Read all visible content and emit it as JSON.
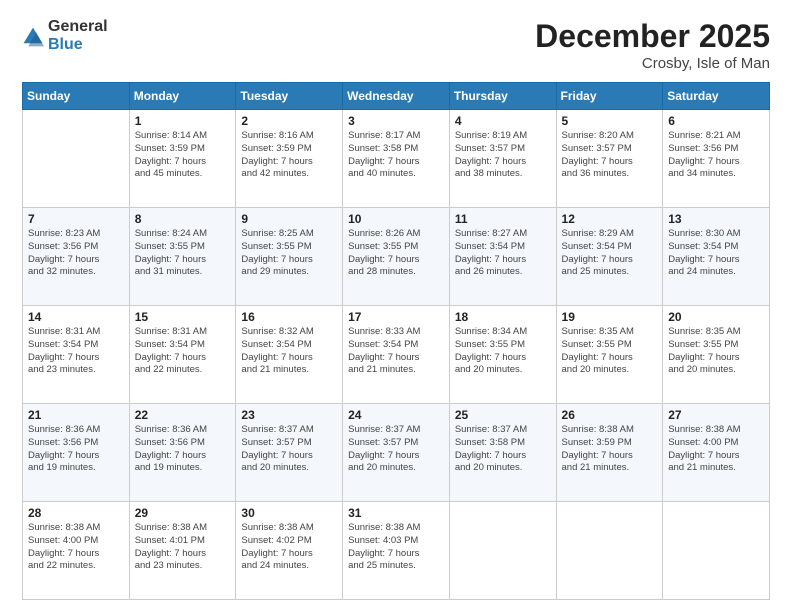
{
  "logo": {
    "general": "General",
    "blue": "Blue"
  },
  "header": {
    "month": "December 2025",
    "location": "Crosby, Isle of Man"
  },
  "days_of_week": [
    "Sunday",
    "Monday",
    "Tuesday",
    "Wednesday",
    "Thursday",
    "Friday",
    "Saturday"
  ],
  "weeks": [
    [
      {
        "day": "",
        "info": ""
      },
      {
        "day": "1",
        "info": "Sunrise: 8:14 AM\nSunset: 3:59 PM\nDaylight: 7 hours\nand 45 minutes."
      },
      {
        "day": "2",
        "info": "Sunrise: 8:16 AM\nSunset: 3:59 PM\nDaylight: 7 hours\nand 42 minutes."
      },
      {
        "day": "3",
        "info": "Sunrise: 8:17 AM\nSunset: 3:58 PM\nDaylight: 7 hours\nand 40 minutes."
      },
      {
        "day": "4",
        "info": "Sunrise: 8:19 AM\nSunset: 3:57 PM\nDaylight: 7 hours\nand 38 minutes."
      },
      {
        "day": "5",
        "info": "Sunrise: 8:20 AM\nSunset: 3:57 PM\nDaylight: 7 hours\nand 36 minutes."
      },
      {
        "day": "6",
        "info": "Sunrise: 8:21 AM\nSunset: 3:56 PM\nDaylight: 7 hours\nand 34 minutes."
      }
    ],
    [
      {
        "day": "7",
        "info": "Sunrise: 8:23 AM\nSunset: 3:56 PM\nDaylight: 7 hours\nand 32 minutes."
      },
      {
        "day": "8",
        "info": "Sunrise: 8:24 AM\nSunset: 3:55 PM\nDaylight: 7 hours\nand 31 minutes."
      },
      {
        "day": "9",
        "info": "Sunrise: 8:25 AM\nSunset: 3:55 PM\nDaylight: 7 hours\nand 29 minutes."
      },
      {
        "day": "10",
        "info": "Sunrise: 8:26 AM\nSunset: 3:55 PM\nDaylight: 7 hours\nand 28 minutes."
      },
      {
        "day": "11",
        "info": "Sunrise: 8:27 AM\nSunset: 3:54 PM\nDaylight: 7 hours\nand 26 minutes."
      },
      {
        "day": "12",
        "info": "Sunrise: 8:29 AM\nSunset: 3:54 PM\nDaylight: 7 hours\nand 25 minutes."
      },
      {
        "day": "13",
        "info": "Sunrise: 8:30 AM\nSunset: 3:54 PM\nDaylight: 7 hours\nand 24 minutes."
      }
    ],
    [
      {
        "day": "14",
        "info": "Sunrise: 8:31 AM\nSunset: 3:54 PM\nDaylight: 7 hours\nand 23 minutes."
      },
      {
        "day": "15",
        "info": "Sunrise: 8:31 AM\nSunset: 3:54 PM\nDaylight: 7 hours\nand 22 minutes."
      },
      {
        "day": "16",
        "info": "Sunrise: 8:32 AM\nSunset: 3:54 PM\nDaylight: 7 hours\nand 21 minutes."
      },
      {
        "day": "17",
        "info": "Sunrise: 8:33 AM\nSunset: 3:54 PM\nDaylight: 7 hours\nand 21 minutes."
      },
      {
        "day": "18",
        "info": "Sunrise: 8:34 AM\nSunset: 3:55 PM\nDaylight: 7 hours\nand 20 minutes."
      },
      {
        "day": "19",
        "info": "Sunrise: 8:35 AM\nSunset: 3:55 PM\nDaylight: 7 hours\nand 20 minutes."
      },
      {
        "day": "20",
        "info": "Sunrise: 8:35 AM\nSunset: 3:55 PM\nDaylight: 7 hours\nand 20 minutes."
      }
    ],
    [
      {
        "day": "21",
        "info": "Sunrise: 8:36 AM\nSunset: 3:56 PM\nDaylight: 7 hours\nand 19 minutes."
      },
      {
        "day": "22",
        "info": "Sunrise: 8:36 AM\nSunset: 3:56 PM\nDaylight: 7 hours\nand 19 minutes."
      },
      {
        "day": "23",
        "info": "Sunrise: 8:37 AM\nSunset: 3:57 PM\nDaylight: 7 hours\nand 20 minutes."
      },
      {
        "day": "24",
        "info": "Sunrise: 8:37 AM\nSunset: 3:57 PM\nDaylight: 7 hours\nand 20 minutes."
      },
      {
        "day": "25",
        "info": "Sunrise: 8:37 AM\nSunset: 3:58 PM\nDaylight: 7 hours\nand 20 minutes."
      },
      {
        "day": "26",
        "info": "Sunrise: 8:38 AM\nSunset: 3:59 PM\nDaylight: 7 hours\nand 21 minutes."
      },
      {
        "day": "27",
        "info": "Sunrise: 8:38 AM\nSunset: 4:00 PM\nDaylight: 7 hours\nand 21 minutes."
      }
    ],
    [
      {
        "day": "28",
        "info": "Sunrise: 8:38 AM\nSunset: 4:00 PM\nDaylight: 7 hours\nand 22 minutes."
      },
      {
        "day": "29",
        "info": "Sunrise: 8:38 AM\nSunset: 4:01 PM\nDaylight: 7 hours\nand 23 minutes."
      },
      {
        "day": "30",
        "info": "Sunrise: 8:38 AM\nSunset: 4:02 PM\nDaylight: 7 hours\nand 24 minutes."
      },
      {
        "day": "31",
        "info": "Sunrise: 8:38 AM\nSunset: 4:03 PM\nDaylight: 7 hours\nand 25 minutes."
      },
      {
        "day": "",
        "info": ""
      },
      {
        "day": "",
        "info": ""
      },
      {
        "day": "",
        "info": ""
      }
    ]
  ]
}
